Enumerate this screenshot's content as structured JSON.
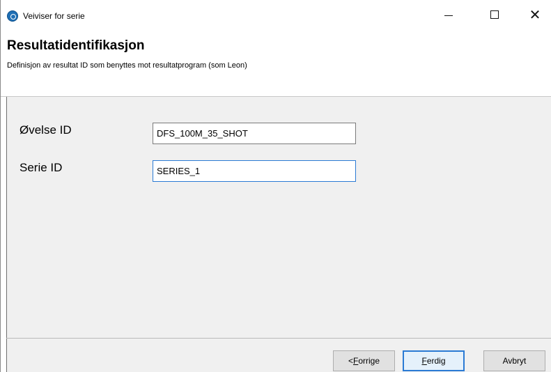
{
  "window": {
    "title": "Veiviser for serie",
    "controls": {
      "minimize_icon": "minimize-icon",
      "maximize_icon": "maximize-icon",
      "close_icon": "close-icon",
      "close_glyph": "✕"
    }
  },
  "header": {
    "title": "Resultatidentifikasjon",
    "subtitle": "Definisjon av resultat ID som benyttes mot resultatprogram (som Leon)"
  },
  "form": {
    "ovelse_label": "Øvelse ID",
    "ovelse_value": "DFS_100M_35_SHOT",
    "serie_label": "Serie ID",
    "serie_value": "SERIES_1"
  },
  "buttons": {
    "prev_prefix": "< ",
    "prev_mnemonic": "F",
    "prev_rest": "orrige",
    "finish_mnemonic": "F",
    "finish_rest": "erdig",
    "cancel": "Avbryt"
  },
  "colors": {
    "focus_accent": "#2a7ad4",
    "panel_background": "#f0f0f0"
  }
}
